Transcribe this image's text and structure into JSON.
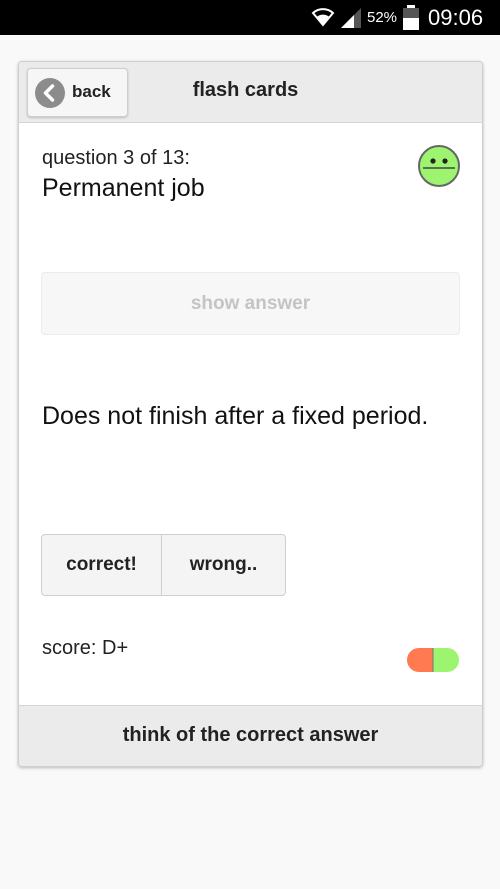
{
  "statusbar": {
    "wifi_icon": "wifi-icon",
    "signal_icon": "signal-icon",
    "battery_percent": "52%",
    "battery_icon": "battery-icon",
    "time": "09:06"
  },
  "header": {
    "back_label": "back",
    "back_icon": "chevron-left-icon",
    "title": "flash cards"
  },
  "card": {
    "question_number": "question 3 of 13:",
    "question": "Permanent job",
    "face_icon": "neutral-face-icon",
    "show_answer_label": "show answer",
    "answer": "Does not finish after a fixed period.",
    "correct_label": "correct!",
    "wrong_label": "wrong..",
    "score": "score: D+",
    "score_icon": "score-pill-icon"
  },
  "footer": {
    "instruction": "think of the correct answer"
  },
  "colors": {
    "face_green": "#9df56f",
    "pill_red": "#ff7a50",
    "pill_green": "#9df56f",
    "header_bg": "#ebebeb",
    "show_answer_text": "#c4c4c4"
  }
}
